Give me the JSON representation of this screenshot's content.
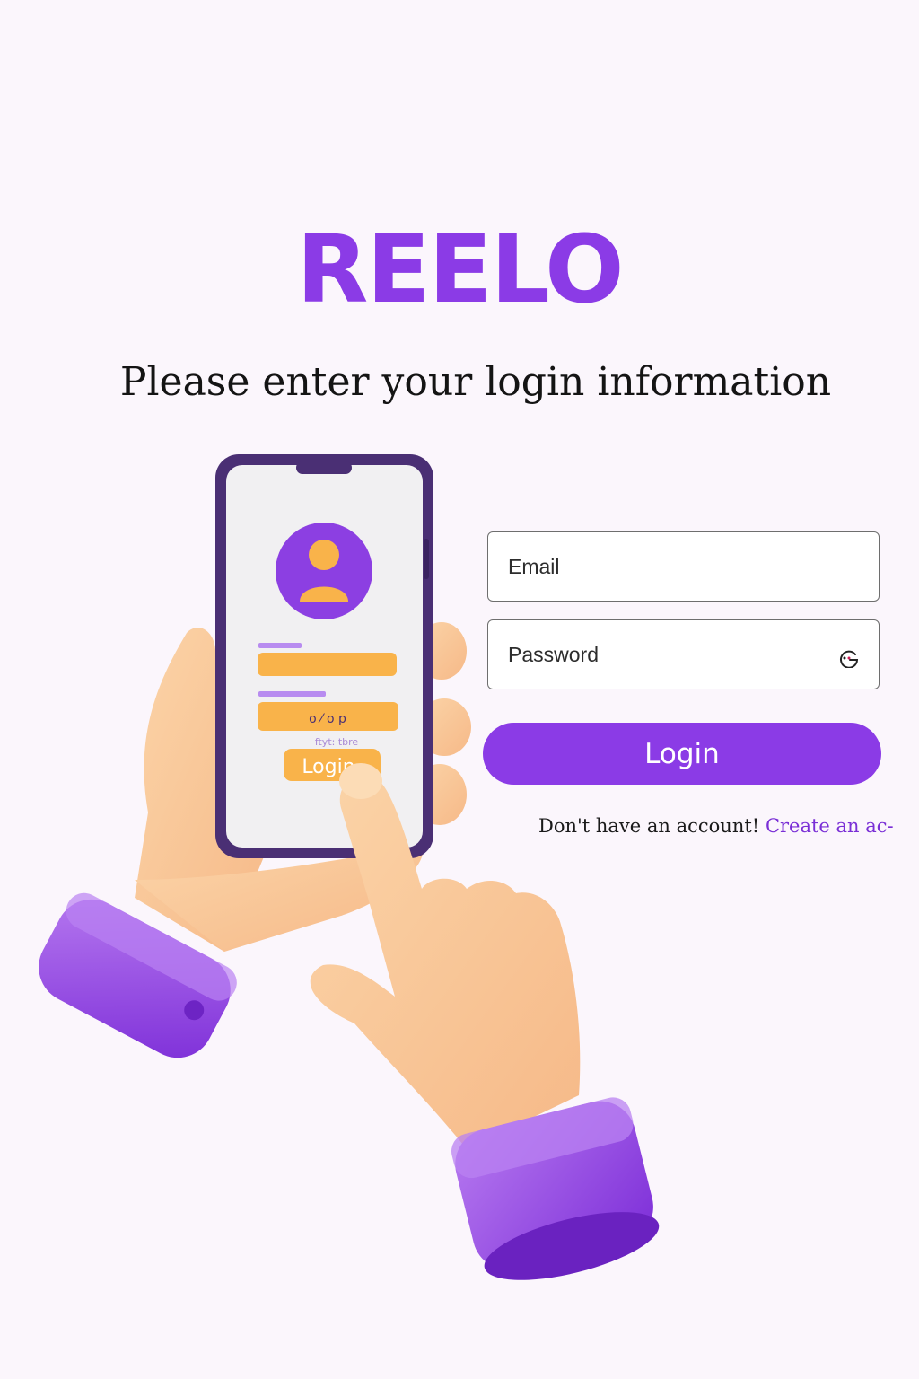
{
  "brand": {
    "name": "REELO",
    "color": "#8b3be6"
  },
  "header": {
    "subtitle": "Please enter your login information"
  },
  "form": {
    "email_placeholder": "Email",
    "password_placeholder": "Password",
    "password_toggle_icon": "eye-icon",
    "login_label": "Login"
  },
  "signup": {
    "prompt": "Don't have an account!",
    "link": "Create an ac-"
  },
  "illustration": {
    "phone_login_label": "Login",
    "phone_field_dots": "o ⁄ o p",
    "phone_small_text": "ftyt: tbre"
  }
}
